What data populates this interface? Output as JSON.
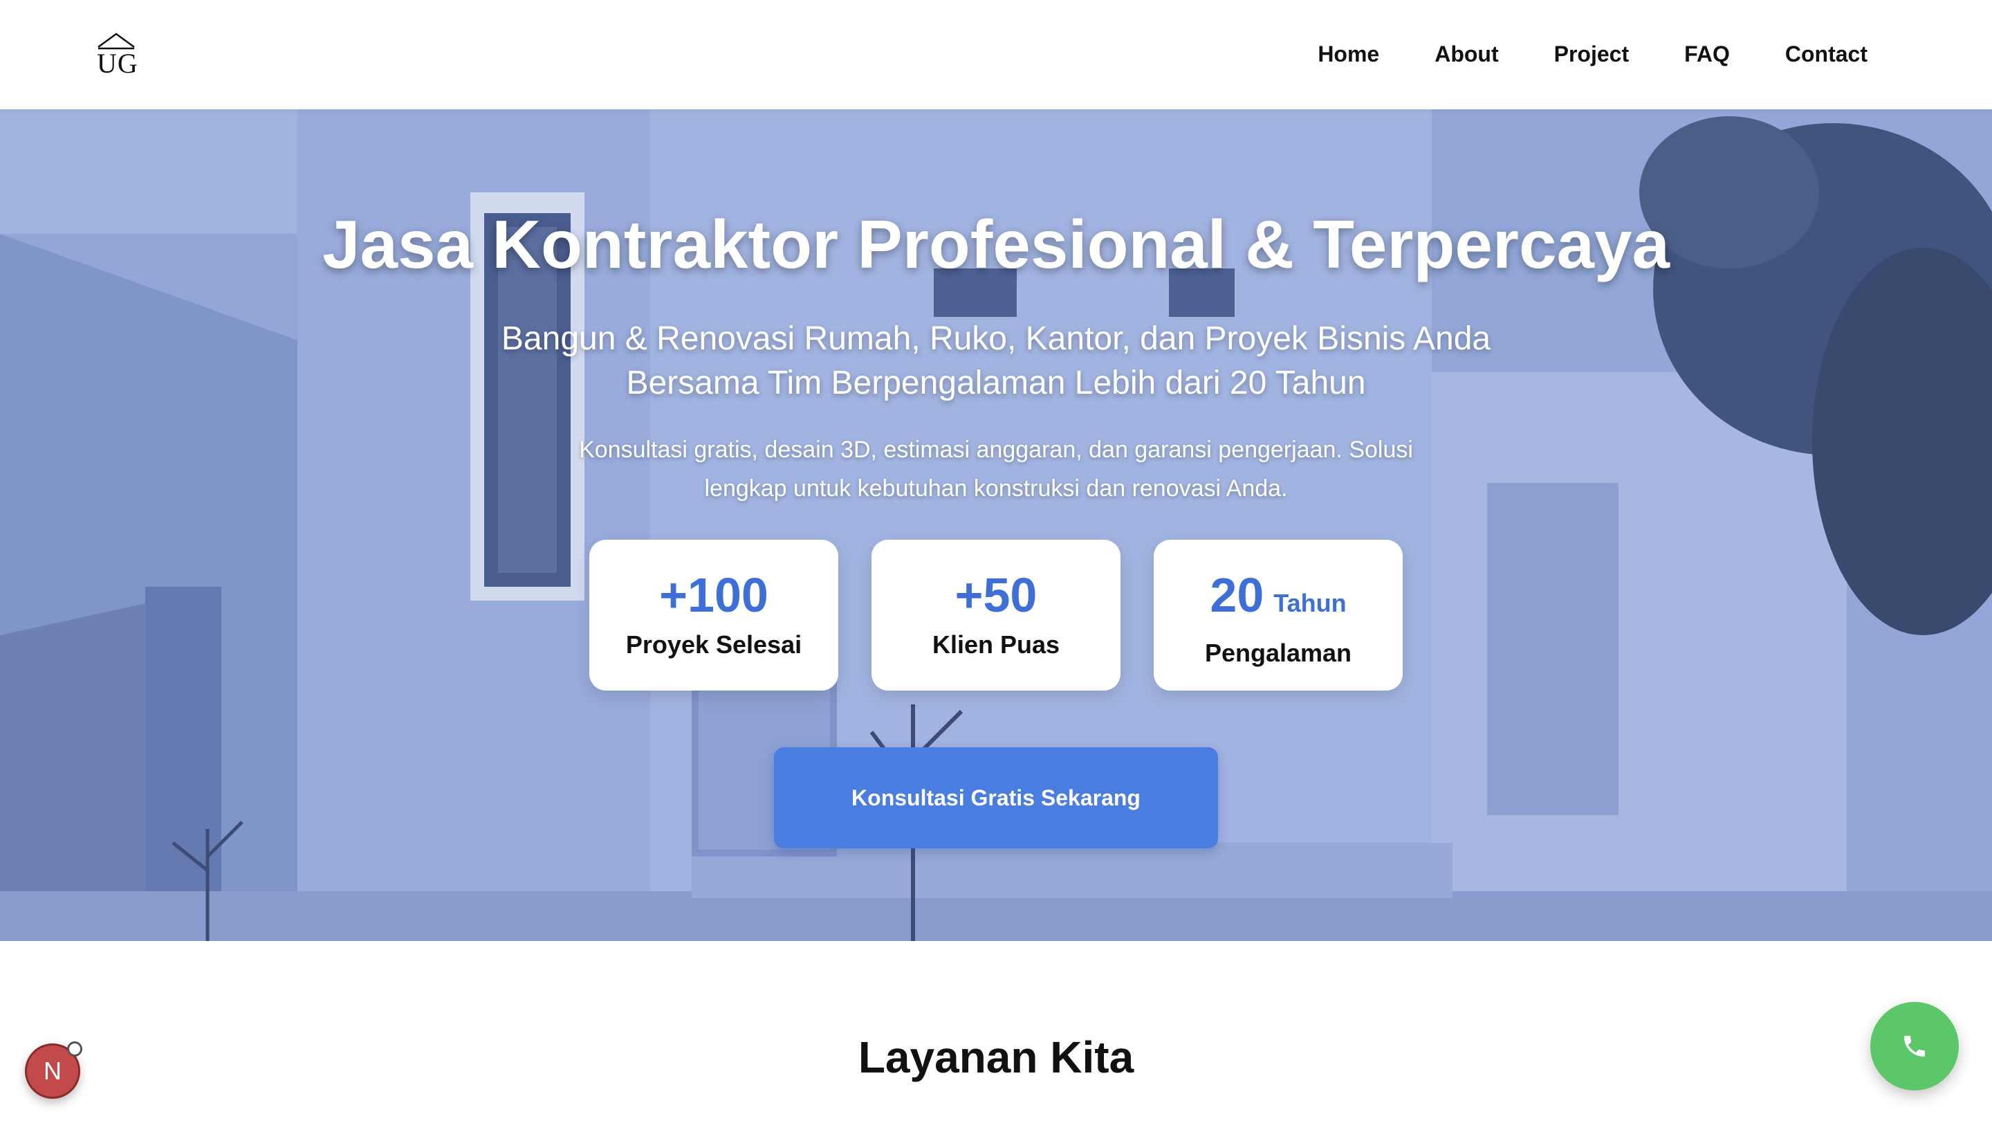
{
  "header": {
    "logo_text": "UG",
    "nav": [
      {
        "label": "Home"
      },
      {
        "label": "About"
      },
      {
        "label": "Project"
      },
      {
        "label": "FAQ"
      },
      {
        "label": "Contact"
      }
    ]
  },
  "hero": {
    "title": "Jasa Kontraktor Profesional & Terpercaya",
    "subtitle_line1": "Bangun & Renovasi Rumah, Ruko, Kantor, dan Proyek Bisnis Anda",
    "subtitle_line2": "Bersama Tim Berpengalaman Lebih dari 20 Tahun",
    "description": "Konsultasi gratis, desain 3D, estimasi anggaran, dan garansi pengerjaan. Solusi lengkap untuk kebutuhan konstruksi dan renovasi Anda.",
    "stats": [
      {
        "value": "+100",
        "unit": "",
        "label": "Proyek Selesai"
      },
      {
        "value": "+50",
        "unit": "",
        "label": "Klien Puas"
      },
      {
        "value": "20",
        "unit": "Tahun",
        "label": "Pengalaman"
      }
    ],
    "cta_label": "Konsultasi Gratis Sekarang"
  },
  "services": {
    "title": "Layanan Kita"
  },
  "widgets": {
    "dev_badge_letter": "N",
    "call_icon": "phone-icon"
  },
  "colors": {
    "accent": "#4a7de0",
    "stat_blue": "#3e6fd6",
    "call_green": "#5cc769"
  }
}
